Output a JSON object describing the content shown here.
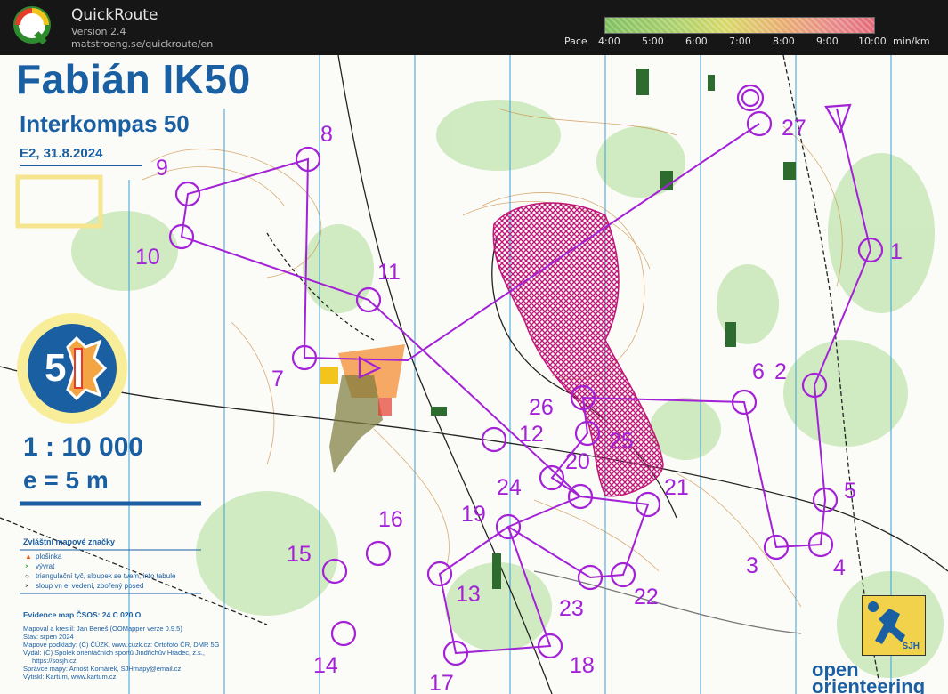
{
  "app": {
    "name": "QuickRoute",
    "version": "Version 2.4",
    "url": "matstroeng.se/quickroute/en"
  },
  "pace_legend": {
    "label": "Pace",
    "ticks": [
      "4:00",
      "5:00",
      "6:00",
      "7:00",
      "8:00",
      "9:00",
      "10:00"
    ],
    "unit": "min/km",
    "colors": [
      "#7fbf5f",
      "#d8d868",
      "#e46a78"
    ]
  },
  "map": {
    "title": "Fabián IK50",
    "subtitle": "Interkompas 50",
    "event": "E2, 31.8.2024",
    "scale": "1 : 10 000",
    "equidistance": "e = 5 m",
    "legend": {
      "title": "Zvláštní mapové značky",
      "items": [
        {
          "symbol": "▲",
          "color": "#e85a1c",
          "label": "plošinka"
        },
        {
          "symbol": "×",
          "color": "#2a9a2a",
          "label": "vývrat"
        },
        {
          "symbol": "○",
          "color": "#222222",
          "label": "triangulační tyč, sloupek se tvem, info tabule"
        },
        {
          "symbol": "×",
          "color": "#222222",
          "label": "sloup vn el vedení, zbořený posed"
        }
      ]
    },
    "evidence": "Evidence map ČSOS: 24 C 020 O",
    "credits": [
      "Mapoval a kreslil: Jan Beneš (OOMapper verze 0.9.5)",
      "Stav: srpen 2024",
      "Mapové podklady: (C) ČÚZK, www.cuzk.cz: Ortofoto ČR, DMR 5G",
      "Vydal: (C) Spolek orientačních sportů Jindřichův Hradec, z.s.,",
      "https://sosjh.cz",
      "Správce mapy: Arnošt Komárek, SJHmapy@email.cz",
      "Vytiskl: Kartum, www.kartum.cz"
    ],
    "badge_text": "5",
    "sjh_logo": "SJH",
    "openorienteering_logo": [
      "open",
      "orienteering"
    ],
    "accent_color": "#1b5fa3",
    "course_color": "#a321d6",
    "forbidden_color": "#c0187a",
    "controls": [
      "1",
      "2",
      "3",
      "4",
      "5",
      "6",
      "7",
      "8",
      "9",
      "10",
      "11",
      "12",
      "13",
      "14",
      "15",
      "16",
      "17",
      "18",
      "19",
      "20",
      "21",
      "22",
      "23",
      "24",
      "25",
      "26",
      "27"
    ]
  }
}
